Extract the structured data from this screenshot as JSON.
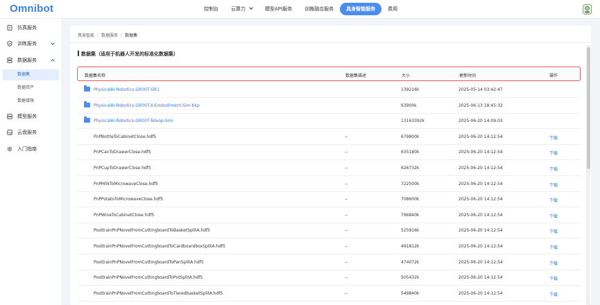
{
  "header": {
    "logo": "Omnibot",
    "nav": [
      {
        "label": "控制台",
        "active": false,
        "dropdown": false
      },
      {
        "label": "云算力",
        "active": false,
        "dropdown": true
      },
      {
        "label": "模型API服务",
        "active": false,
        "dropdown": false
      },
      {
        "label": "训推融合服务",
        "active": false,
        "dropdown": false
      },
      {
        "label": "具身智能服务",
        "active": true,
        "dropdown": false
      },
      {
        "label": "费用",
        "active": false,
        "dropdown": false
      }
    ]
  },
  "sidebar": {
    "items": [
      {
        "label": "仿真服务",
        "icon": "document-icon"
      },
      {
        "label": "训练服务",
        "icon": "shield-icon",
        "expandable": true
      },
      {
        "label": "数据服务",
        "icon": "database-icon",
        "expandable": true,
        "expanded": true
      },
      {
        "label": "模型服务",
        "icon": "server-icon"
      },
      {
        "label": "云盘服务",
        "icon": "disk-icon"
      },
      {
        "label": "入门指南",
        "icon": "gear-icon"
      }
    ],
    "subitems": [
      {
        "label": "数据集",
        "active": true
      },
      {
        "label": "数据资产",
        "active": false
      },
      {
        "label": "数据增强",
        "active": false
      }
    ]
  },
  "breadcrumb": [
    "具身智能",
    "数据服务",
    "数据集"
  ],
  "page_title": "数据集（适用于机器人开发的标准化数据集）",
  "table": {
    "headers": {
      "name": "数据集名称",
      "desc": "数据集描述",
      "size": "大小",
      "updated": "更新时间",
      "action": "操作"
    },
    "rows": [
      {
        "name": "PhysicalAI-Robotics-GR00T-GR1",
        "folder": true,
        "desc": "",
        "size": "139216k",
        "updated": "2025-05-14 03:42:47",
        "action": ""
      },
      {
        "name": "PhysicalAI-Robotics-GR00T-X-Embodiment-Sim-bkp",
        "folder": true,
        "desc": "",
        "size": "63900k",
        "updated": "2025-06-13 18:45:32",
        "action": ""
      },
      {
        "name": "PhysicalAI-Robotics-GR00T-Teleop-Sim",
        "folder": true,
        "desc": "",
        "size": "13163392k",
        "updated": "2025-06-20 14:09:03",
        "action": ""
      },
      {
        "name": "PnPBottleToCabinetClose.hdf5",
        "folder": false,
        "desc": "--",
        "size": "679800k",
        "updated": "2025-06-20 14:12:54",
        "action": "下载"
      },
      {
        "name": "PnPCanToDrawerClose.hdf5",
        "folder": false,
        "desc": "--",
        "size": "635180k",
        "updated": "2025-06-20 14:12:54",
        "action": "下载"
      },
      {
        "name": "PnPCupToDrawerClose.hdf5",
        "folder": false,
        "desc": "--",
        "size": "626732k",
        "updated": "2025-06-20 14:12:54",
        "action": "下载"
      },
      {
        "name": "PnPMilkToMicrowaveClose.hdf5",
        "folder": false,
        "desc": "--",
        "size": "722500k",
        "updated": "2025-06-20 14:12:54",
        "action": "下载"
      },
      {
        "name": "PnPPotatoToMicrowaveClose.hdf5",
        "folder": false,
        "desc": "--",
        "size": "708600k",
        "updated": "2025-06-20 14:12:54",
        "action": "下载"
      },
      {
        "name": "PnPWineToCabinetClose.hdf5",
        "folder": false,
        "desc": "--",
        "size": "796840k",
        "updated": "2025-06-20 14:12:54",
        "action": "下载"
      },
      {
        "name": "PosttrainPnPNovelFromCuttingboardToBasketSplitA.hdf5",
        "folder": false,
        "desc": "--",
        "size": "525916k",
        "updated": "2025-06-20 14:12:54",
        "action": "下载"
      },
      {
        "name": "PosttrainPnPNovelFromCuttingboardToCardboardboxSplitA.hdf5",
        "folder": false,
        "desc": "--",
        "size": "491812k",
        "updated": "2025-06-20 14:12:54",
        "action": "下载"
      },
      {
        "name": "PosttrainPnPNovelFromCuttingboardToPanSplitA.hdf5",
        "folder": false,
        "desc": "--",
        "size": "474072k",
        "updated": "2025-06-20 14:12:54",
        "action": "下载"
      },
      {
        "name": "PosttrainPnPNovelFromCuttingboardToPotSplitA.hdf5",
        "folder": false,
        "desc": "--",
        "size": "505432k",
        "updated": "2025-06-20 14:12:54",
        "action": "下载"
      },
      {
        "name": "PosttrainPnPNovelFromCuttingboardToTieredbasketSplitA.hdf5",
        "folder": false,
        "desc": "--",
        "size": "549840k",
        "updated": "2025-06-20 14:12:54",
        "action": "下载"
      }
    ]
  },
  "colors": {
    "accent": "#4a8cf0",
    "link": "#3478e0",
    "highlight_border": "#e45a5a"
  }
}
